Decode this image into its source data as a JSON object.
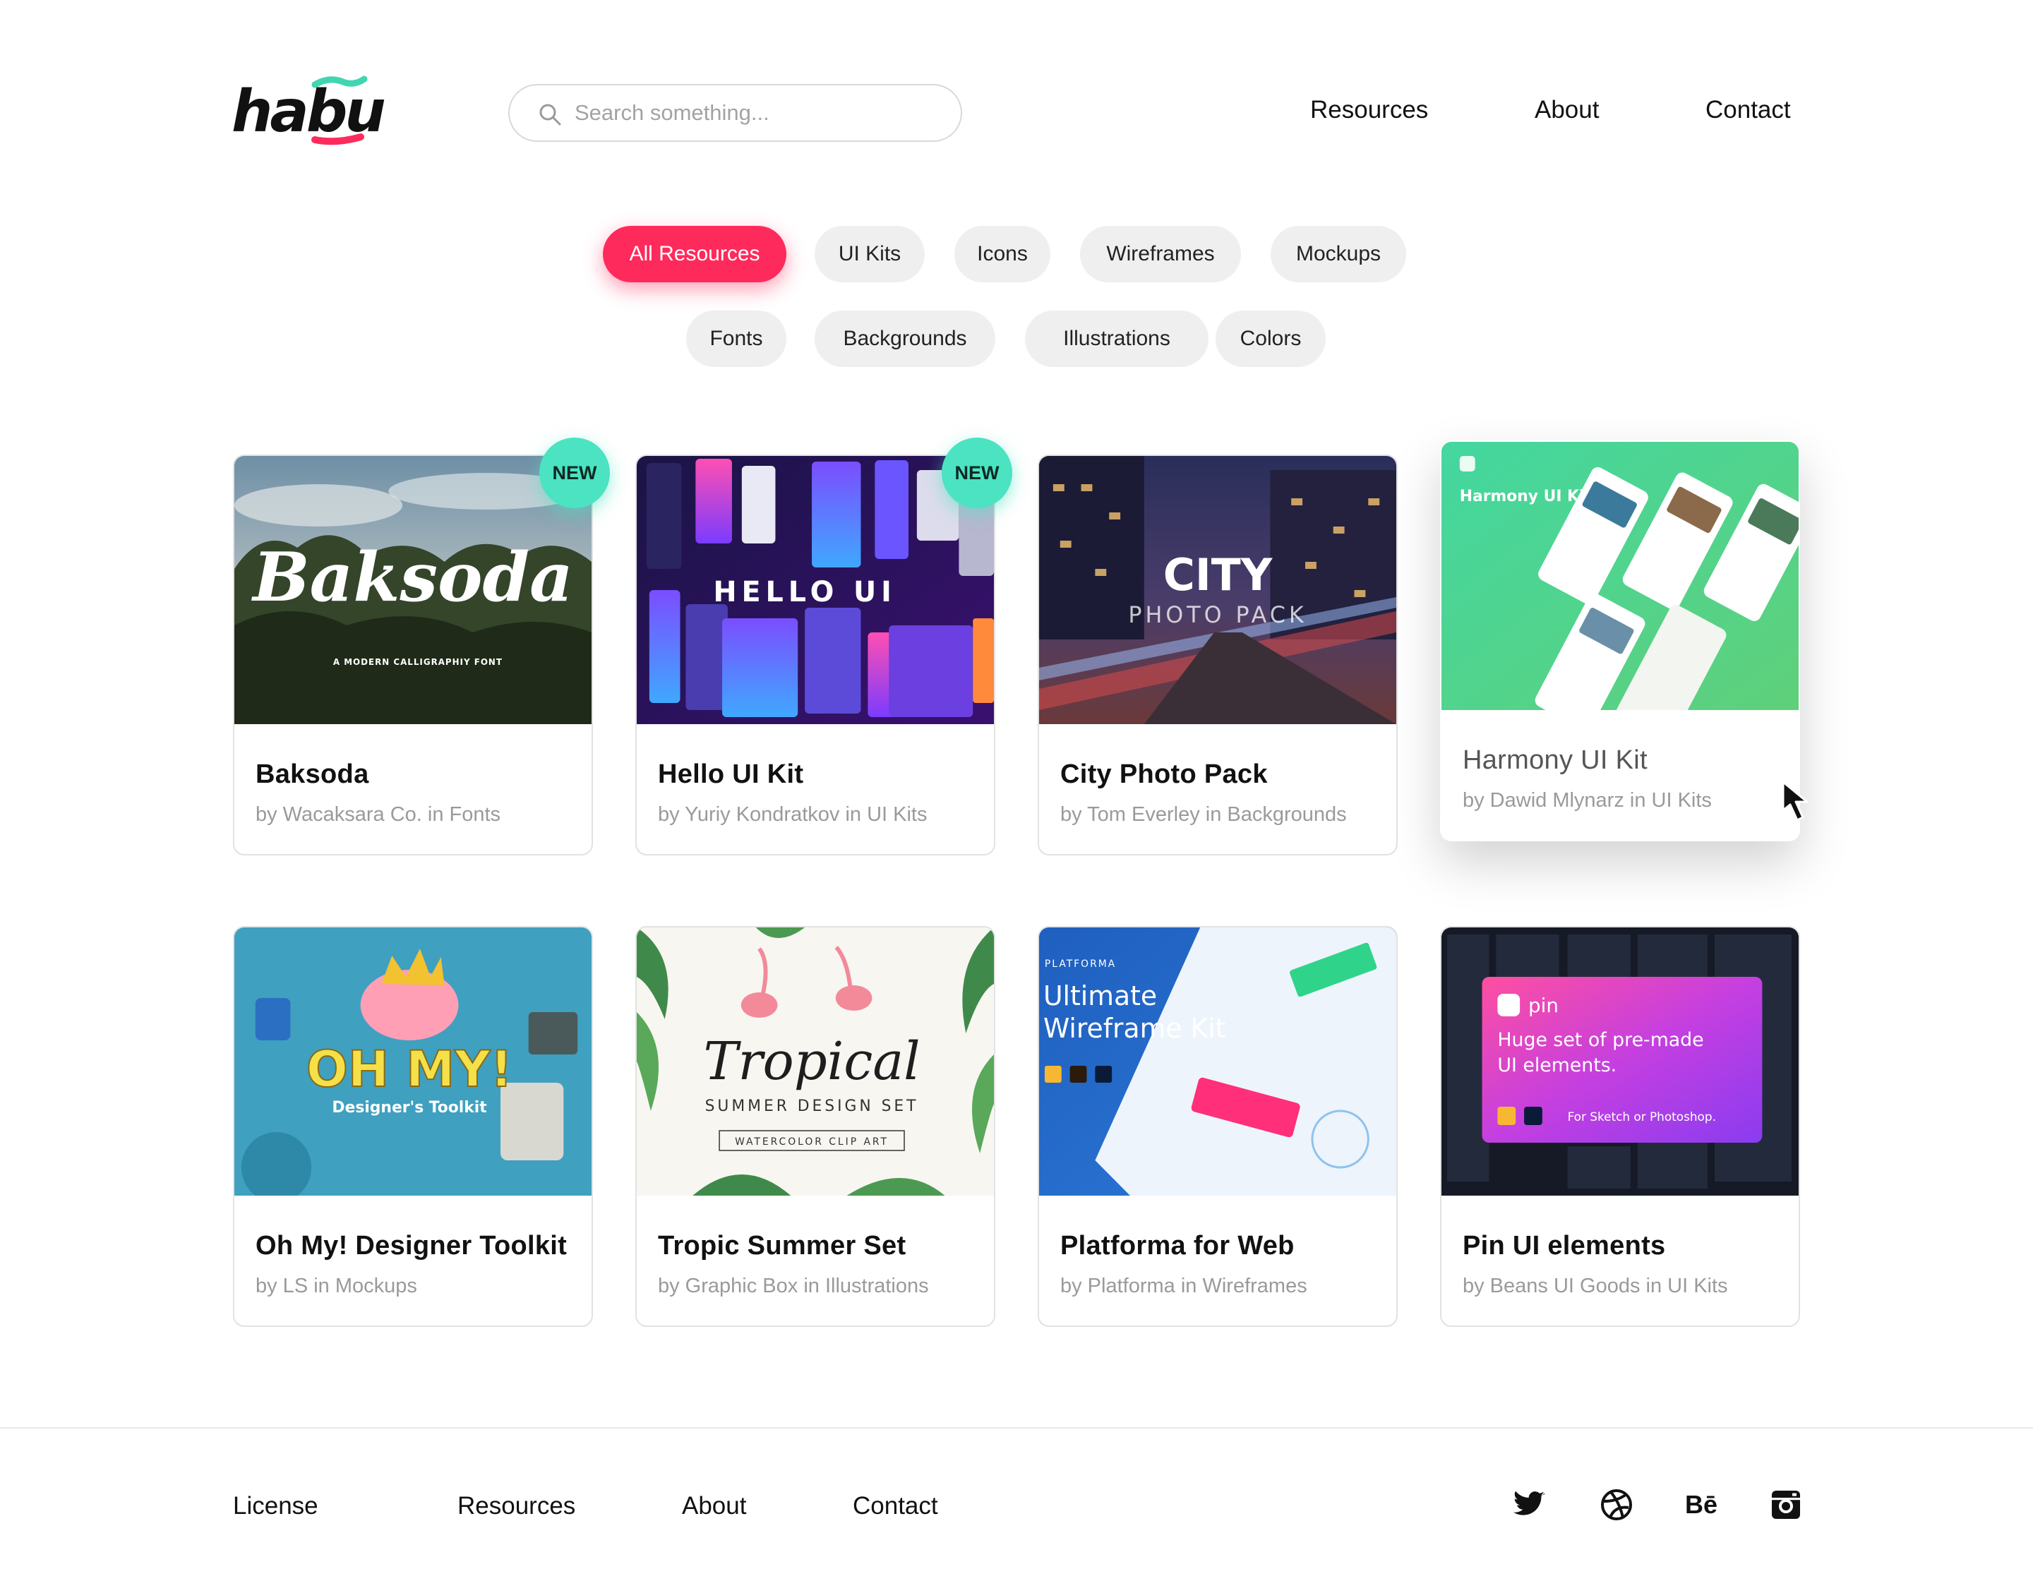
{
  "brand": {
    "logo_text": "habu",
    "accent": "#ff2a5c",
    "badge_color": "#4be3c1"
  },
  "search": {
    "placeholder": "Search something..."
  },
  "nav": {
    "resources": "Resources",
    "about": "About",
    "contact": "Contact"
  },
  "filters": [
    {
      "label": "All Resources",
      "active": true
    },
    {
      "label": "UI Kits"
    },
    {
      "label": "Icons"
    },
    {
      "label": "Wireframes"
    },
    {
      "label": "Mockups"
    },
    {
      "label": "Fonts"
    },
    {
      "label": "Backgrounds"
    },
    {
      "label": "Illustrations"
    },
    {
      "label": "Colors"
    }
  ],
  "cards": [
    {
      "title": "Baksoda",
      "subtitle": "by Wacaksara Co. in Fonts",
      "badge": "NEW",
      "thumb": {
        "headline": "Baksoda",
        "tagline": "A MODERN CALLIGRAPHIY FONT"
      }
    },
    {
      "title": "Hello UI Kit",
      "subtitle": "by Yuriy Kondratkov in UI Kits",
      "badge": "NEW",
      "thumb": {
        "headline": "HELLO UI"
      }
    },
    {
      "title": "City Photo Pack",
      "subtitle": "by Tom Everley in Backgrounds",
      "thumb": {
        "headline": "CITY",
        "tagline": "PHOTO PACK"
      }
    },
    {
      "title": "Harmony UI Kit",
      "subtitle": "by Dawid Mlynarz in UI Kits",
      "thumb": {
        "headline": "Harmony UI Kit"
      }
    },
    {
      "title": "Oh My! Designer Toolkit",
      "subtitle": "by LS in Mockups",
      "thumb": {
        "headline": "OH MY!",
        "tagline": "Designer's Toolkit"
      }
    },
    {
      "title": "Tropic Summer Set",
      "subtitle": "by Graphic Box in Illustrations",
      "thumb": {
        "headline": "Tropical",
        "tagline": "SUMMER DESIGN SET",
        "note": "WATERCOLOR CLIP ART"
      }
    },
    {
      "title": "Platforma for Web",
      "subtitle": "by Platforma in Wireframes",
      "thumb": {
        "eyebrow": "PLATFORMA",
        "headline": "Ultimate",
        "headline2": "Wireframe Kit"
      }
    },
    {
      "title": "Pin UI elements",
      "subtitle": "by Beans UI Goods in UI Kits",
      "thumb": {
        "brand": "pin",
        "headline": "Huge set of pre-made",
        "headline2": "UI elements.",
        "note": "For Sketch or Photoshop."
      }
    }
  ],
  "footer": {
    "license": "License",
    "resources": "Resources",
    "about": "About",
    "contact": "Contact",
    "social": [
      "twitter-icon",
      "dribbble-icon",
      "behance-icon",
      "instagram-icon"
    ],
    "behance_label": "Bē"
  }
}
